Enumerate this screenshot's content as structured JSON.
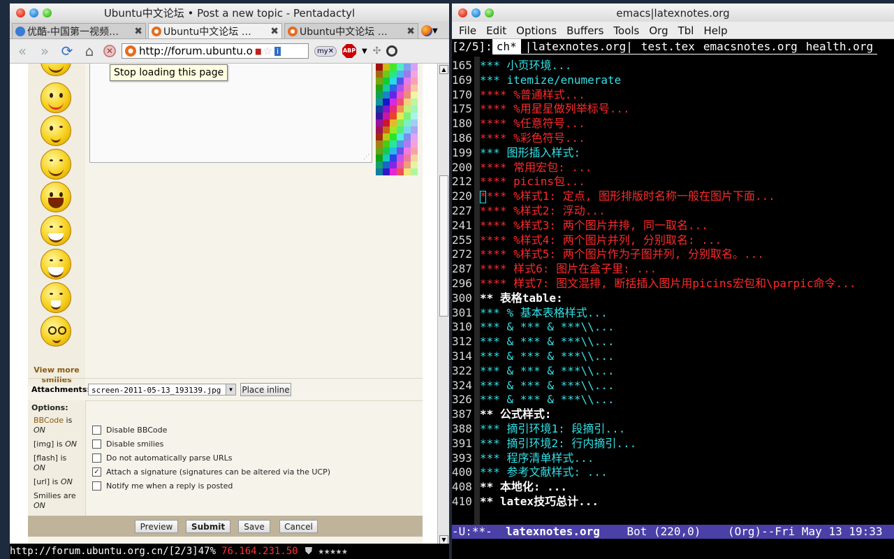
{
  "firefox": {
    "title": "Ubuntu中文论坛 • Post a new topic - Pentadactyl",
    "tabs": [
      {
        "label": "优酷-中国第一视频…",
        "icon_color": "#3a7bd5"
      },
      {
        "label": "Ubuntu中文论坛 …",
        "icon_color": "#e86b1c"
      },
      {
        "label": "Ubuntu中文论坛 …",
        "icon_color": "#e86b1c"
      }
    ],
    "url": "http://forum.ubuntu.o",
    "tooltip": "Stop loading this page",
    "smilies_link": "View more smilies",
    "attachments_label": "Attachments:",
    "attachment_file": "screen-2011-05-13_193139.jpg",
    "place_inline": "Place inline",
    "options_label": "Options:",
    "option_states": [
      {
        "name": "BBCode",
        "state": "is ON"
      },
      {
        "name": "[img] is",
        "state": "ON"
      },
      {
        "name": "[flash] is",
        "state": "ON"
      },
      {
        "name": "[url] is",
        "state": "ON"
      },
      {
        "name": "Smilies are",
        "state": "ON"
      }
    ],
    "options": [
      {
        "label": "Disable BBCode",
        "checked": false
      },
      {
        "label": "Disable smilies",
        "checked": false
      },
      {
        "label": "Do not automatically parse URLs",
        "checked": false
      },
      {
        "label": "Attach a signature (signatures can be altered via the UCP)",
        "checked": true
      },
      {
        "label": "Notify me when a reply is posted",
        "checked": false
      }
    ],
    "buttons": {
      "preview": "Preview",
      "submit": "Submit",
      "save": "Save",
      "cancel": "Cancel"
    },
    "status": {
      "url": "http://forum.ubuntu.org.cn/[2/3]47%",
      "ip": "76.164.231.50"
    }
  },
  "emacs": {
    "title": "emacs|latexnotes.org",
    "menu": [
      "File",
      "Edit",
      "Options",
      "Buffers",
      "Tools",
      "Org",
      "Tbl",
      "Help"
    ],
    "tabs": [
      "[2/5]:",
      "ch*",
      "|latexnotes.org|",
      "test.tex",
      "emacsnotes.org",
      "health.org"
    ],
    "lines": [
      {
        "n": "165",
        "text": "*** 小页环境...",
        "lvl": 3
      },
      {
        "n": "169",
        "text": "*** itemize/enumerate",
        "lvl": 3
      },
      {
        "n": "170",
        "text": "**** %普通样式...",
        "lvl": 4
      },
      {
        "n": "175",
        "text": "**** %用星星做列举标号...",
        "lvl": 4
      },
      {
        "n": "180",
        "text": "**** %任意符号...",
        "lvl": 4
      },
      {
        "n": "186",
        "text": "**** %彩色符号...",
        "lvl": 4
      },
      {
        "n": "199",
        "text": "*** 图形插入样式:",
        "lvl": 3
      },
      {
        "n": "200",
        "text": "**** 常用宏包: ...",
        "lvl": 4
      },
      {
        "n": "212",
        "text": "**** picins包...",
        "lvl": 4
      },
      {
        "n": "220",
        "text": "**** %样式1: 定点, 图形排版时名称一般在图片下面...",
        "lvl": 4,
        "cursor": true
      },
      {
        "n": "227",
        "text": "**** %样式2: 浮动...",
        "lvl": 4
      },
      {
        "n": "241",
        "text": "**** %样式3: 两个图片并排, 同一取名...",
        "lvl": 4
      },
      {
        "n": "255",
        "text": "**** %样式4: 两个图片并列, 分别取名: ...",
        "lvl": 4
      },
      {
        "n": "272",
        "text": "**** %样式5: 两个图片作为子图并列, 分别取名。...",
        "lvl": 4
      },
      {
        "n": "287",
        "text": "**** 样式6: 图片在盒子里: ...",
        "lvl": 4
      },
      {
        "n": "296",
        "text": "**** 样式7: 图文混排, 断括插入图片用picins宏包和\\parpic命令...",
        "lvl": 4
      },
      {
        "n": "300",
        "text": "** 表格table:",
        "lvl": 2
      },
      {
        "n": "301",
        "text": "*** % 基本表格样式...",
        "lvl": 3
      },
      {
        "n": "310",
        "text": "*** & *** & ***\\\\...",
        "lvl": 3
      },
      {
        "n": "312",
        "text": "*** & *** & ***\\\\...",
        "lvl": 3
      },
      {
        "n": "314",
        "text": "*** & *** & ***\\\\...",
        "lvl": 3
      },
      {
        "n": "322",
        "text": "*** & *** & ***\\\\...",
        "lvl": 3
      },
      {
        "n": "324",
        "text": "*** & *** & ***\\\\...",
        "lvl": 3
      },
      {
        "n": "326",
        "text": "*** & *** & ***\\\\...",
        "lvl": 3
      },
      {
        "n": "387",
        "text": "** 公式样式:",
        "lvl": 2
      },
      {
        "n": "388",
        "text": "*** 摘引环境1: 段摘引...",
        "lvl": 3
      },
      {
        "n": "391",
        "text": "*** 摘引环境2: 行内摘引...",
        "lvl": 3
      },
      {
        "n": "393",
        "text": "*** 程序清单样式...",
        "lvl": 3
      },
      {
        "n": "400",
        "text": "*** 参考文献样式: ...",
        "lvl": 3
      },
      {
        "n": "408",
        "text": "** 本地化: ...",
        "lvl": 2
      },
      {
        "n": "410",
        "text": "** latex技巧总计...",
        "lvl": 2
      }
    ],
    "modeline": {
      "state": "-U:**-",
      "buffer": "latexnotes.org",
      "pos": "Bot (220,0)",
      "mode": "(Org)--Fri May 13 19:33"
    }
  },
  "colors": {
    "org_level2": "#ffffff",
    "org_level3": "#34e0e6",
    "org_level4": "#ff2a2a",
    "modeline_bg": "#4b3fa8"
  }
}
